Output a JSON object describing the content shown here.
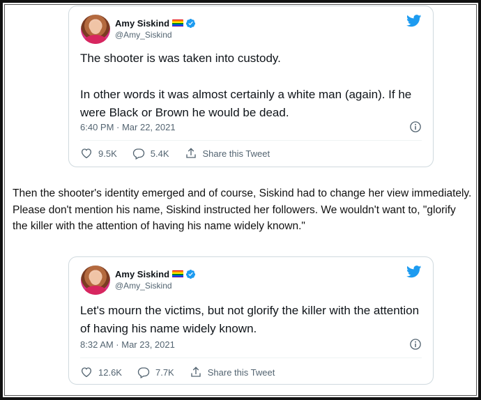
{
  "tweets": [
    {
      "name": "Amy Siskind",
      "handle": "@Amy_Siskind",
      "text": "The shooter is was taken into custody.\n\nIn other words it was almost certainly a white man (again).  If he were Black or Brown he would be dead.",
      "timestamp": "6:40 PM · Mar 22, 2021",
      "likes": "9.5K",
      "replies": "5.4K",
      "share_label": "Share this Tweet"
    },
    {
      "name": "Amy Siskind",
      "handle": "@Amy_Siskind",
      "text": "Let's mourn the victims, but not glorify the killer with the attention of having his name widely known.",
      "timestamp": "8:32 AM · Mar 23, 2021",
      "likes": "12.6K",
      "replies": "7.7K",
      "share_label": "Share this Tweet"
    }
  ],
  "paragraph": "Then the shooter's identity emerged and of course, Siskind had to change her view immediately. Please don't mention his name, Siskind instructed her followers. We wouldn't want to, \"glorify the killer with the attention of having his name widely known.\"",
  "colors": {
    "twitter_blue": "#1d9bf0",
    "secondary_text": "#536471",
    "border": "#cfd9de"
  },
  "icons": [
    "twitter-bird-icon",
    "verified-badge-icon",
    "rainbow-flag-icon",
    "info-icon",
    "heart-icon",
    "reply-icon",
    "share-icon"
  ]
}
